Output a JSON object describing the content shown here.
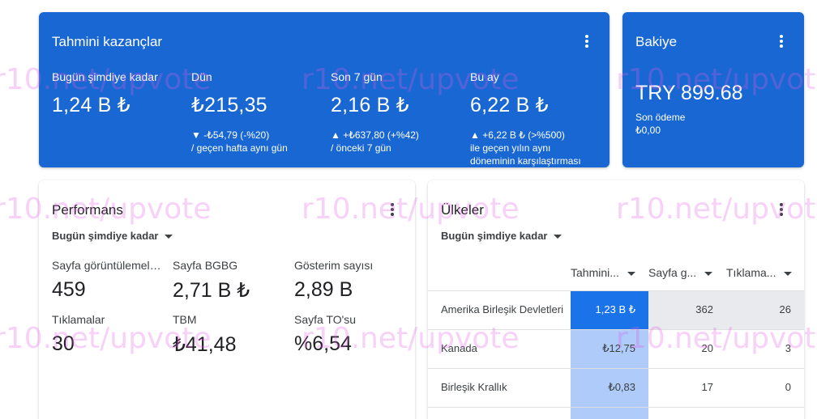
{
  "earnings": {
    "title": "Tahmini kazançlar",
    "columns": [
      {
        "label": "Bugün şimdiye kadar",
        "value": "1,24 B ₺",
        "change": "",
        "sub1": "",
        "sub2": ""
      },
      {
        "label": "Dün",
        "value": "₺215,35",
        "change": "▼ -₺54,79 (-%20)",
        "sub1": "/ geçen hafta aynı gün",
        "sub2": ""
      },
      {
        "label": "Son 7 gün",
        "value": "2,16 B ₺",
        "change": "▲ +₺637,80 (+%42)",
        "sub1": "/ önceki 7 gün",
        "sub2": ""
      },
      {
        "label": "Bu ay",
        "value": "6,22 B ₺",
        "change": "▲ +6,22 B ₺ (>%500)",
        "sub1": "ile geçen yılın aynı",
        "sub2": "döneminin karşılaştırması"
      }
    ]
  },
  "balance": {
    "title": "Bakiye",
    "value": "TRY 899.68",
    "last_payment_label": "Son ödeme",
    "last_payment_value": "₺0,00"
  },
  "performance": {
    "title": "Performans",
    "range": "Bugün şimdiye kadar",
    "metrics": [
      {
        "label": "Sayfa görüntülemeleri",
        "value": "459"
      },
      {
        "label": "Sayfa BGBG",
        "value": "2,71 B ₺"
      },
      {
        "label": "Gösterim sayısı",
        "value": "2,89 B"
      },
      {
        "label": "Tıklamalar",
        "value": "30"
      },
      {
        "label": "TBM",
        "value": "₺41,48"
      },
      {
        "label": "Sayfa TO'su",
        "value": "%6,54"
      }
    ]
  },
  "countries": {
    "title": "Ülkeler",
    "range": "Bugün şimdiye kadar",
    "headers": [
      "Tahmini...",
      "Sayfa g...",
      "Tıklama..."
    ],
    "rows": [
      {
        "name": "Amerika Birleşik Devletleri",
        "earnings": "1,23 B ₺",
        "pageviews": "362",
        "clicks": "26"
      },
      {
        "name": "Kanada",
        "earnings": "₺12,75",
        "pageviews": "20",
        "clicks": "3"
      },
      {
        "name": "Birleşik Krallık",
        "earnings": "₺0,83",
        "pageviews": "17",
        "clicks": "0"
      }
    ]
  },
  "watermark": "r10.net/upvote",
  "colors": {
    "accent_blue": "#1967d2",
    "highlight_blue": "#1a73e8",
    "light_blue": "#aecbfa",
    "grey": "#e8eaed"
  }
}
